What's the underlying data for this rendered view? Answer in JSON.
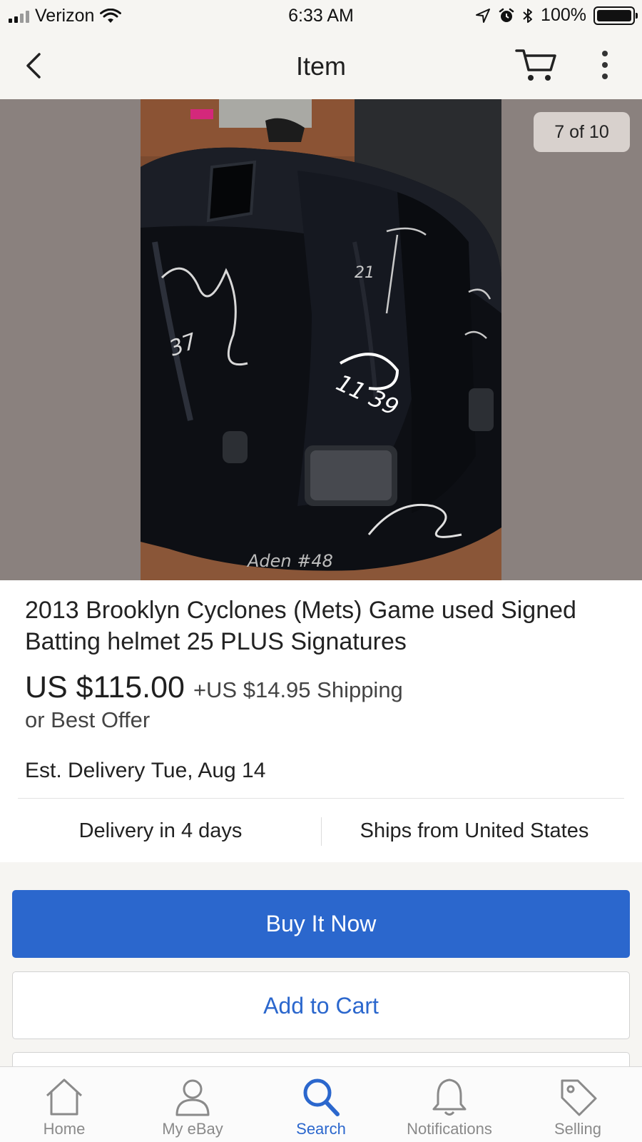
{
  "status_bar": {
    "carrier": "Verizon",
    "time": "6:33 AM",
    "battery": "100%"
  },
  "nav": {
    "title": "Item"
  },
  "photo": {
    "counter": "7 of 10",
    "signatures": [
      "37",
      "11 39",
      "21",
      "Aden #48"
    ]
  },
  "item": {
    "title": "2013 Brooklyn Cyclones (Mets) Game used Signed Batting helmet 25 PLUS Signatures",
    "price": "US $115.00",
    "shipping": "+US $14.95 Shipping",
    "best_offer": "or Best Offer",
    "est_delivery_label": "Est. Delivery",
    "est_delivery_date": "Tue, Aug 14",
    "delivery_days": "Delivery in 4 days",
    "ships_from": "Ships from United States"
  },
  "actions": {
    "buy_now": "Buy It Now",
    "add_to_cart": "Add to Cart"
  },
  "tabs": [
    {
      "label": "Home",
      "icon": "home-icon",
      "active": false
    },
    {
      "label": "My eBay",
      "icon": "person-icon",
      "active": false
    },
    {
      "label": "Search",
      "icon": "search-icon",
      "active": true
    },
    {
      "label": "Notifications",
      "icon": "bell-icon",
      "active": false
    },
    {
      "label": "Selling",
      "icon": "tag-icon",
      "active": false
    }
  ],
  "colors": {
    "accent": "#2b67cd",
    "photo_background": "#8a817e",
    "inactive_tab": "#8a8a8a"
  }
}
